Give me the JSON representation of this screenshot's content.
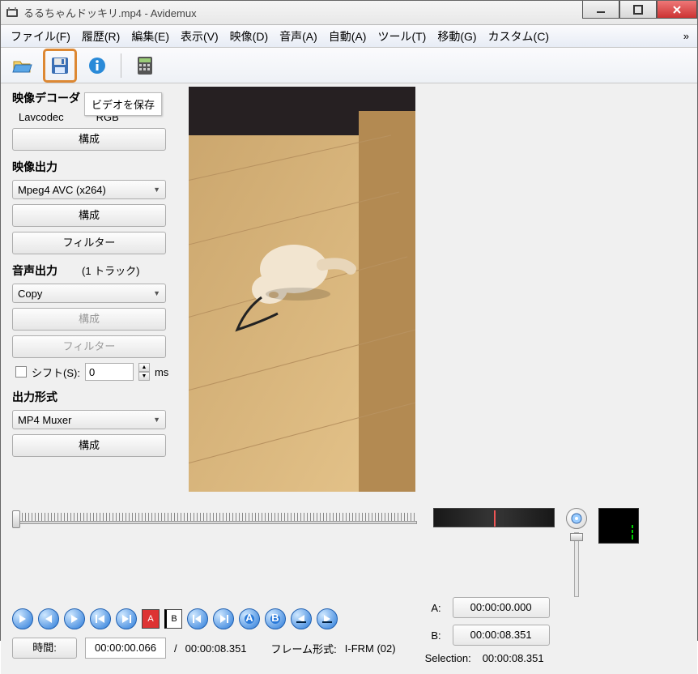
{
  "window": {
    "title": "るるちゃんドッキリ.mp4 - Avidemux"
  },
  "menu": {
    "file": "ファイル(F)",
    "history": "履歴(R)",
    "edit": "編集(E)",
    "view": "表示(V)",
    "video": "映像(D)",
    "audio": "音声(A)",
    "auto": "自動(A)",
    "tools": "ツール(T)",
    "go": "移動(G)",
    "custom": "カスタム(C)"
  },
  "tooltip": {
    "save_video": "ビデオを保存"
  },
  "decoder": {
    "heading": "映像デコーダ",
    "codec": "Lavcodec",
    "colorspace": "RGB",
    "configure": "構成"
  },
  "video_out": {
    "heading": "映像出力",
    "codec": "Mpeg4 AVC (x264)",
    "configure": "構成",
    "filter": "フィルター"
  },
  "audio_out": {
    "heading": "音声出力",
    "tracks": "(1 トラック)",
    "mode": "Copy",
    "configure": "構成",
    "filter": "フィルター",
    "shift_label": "シフト(S):",
    "shift_value": "0",
    "shift_unit": "ms"
  },
  "format": {
    "heading": "出力形式",
    "muxer": "MP4 Muxer",
    "configure": "構成"
  },
  "selection": {
    "a_label": "A:",
    "a_value": "00:00:00.000",
    "b_label": "B:",
    "b_value": "00:00:08.351",
    "sel_label": "Selection:",
    "sel_value": "00:00:08.351"
  },
  "time": {
    "label": "時間:",
    "current": "00:00:00.066",
    "sep": "/",
    "total": "00:00:08.351",
    "frame_label": "フレーム形式:",
    "frame_value": "I-FRM (02)"
  },
  "icons": {
    "open": "open-icon",
    "save": "save-icon",
    "info": "info-icon",
    "calc": "calculator-icon"
  }
}
